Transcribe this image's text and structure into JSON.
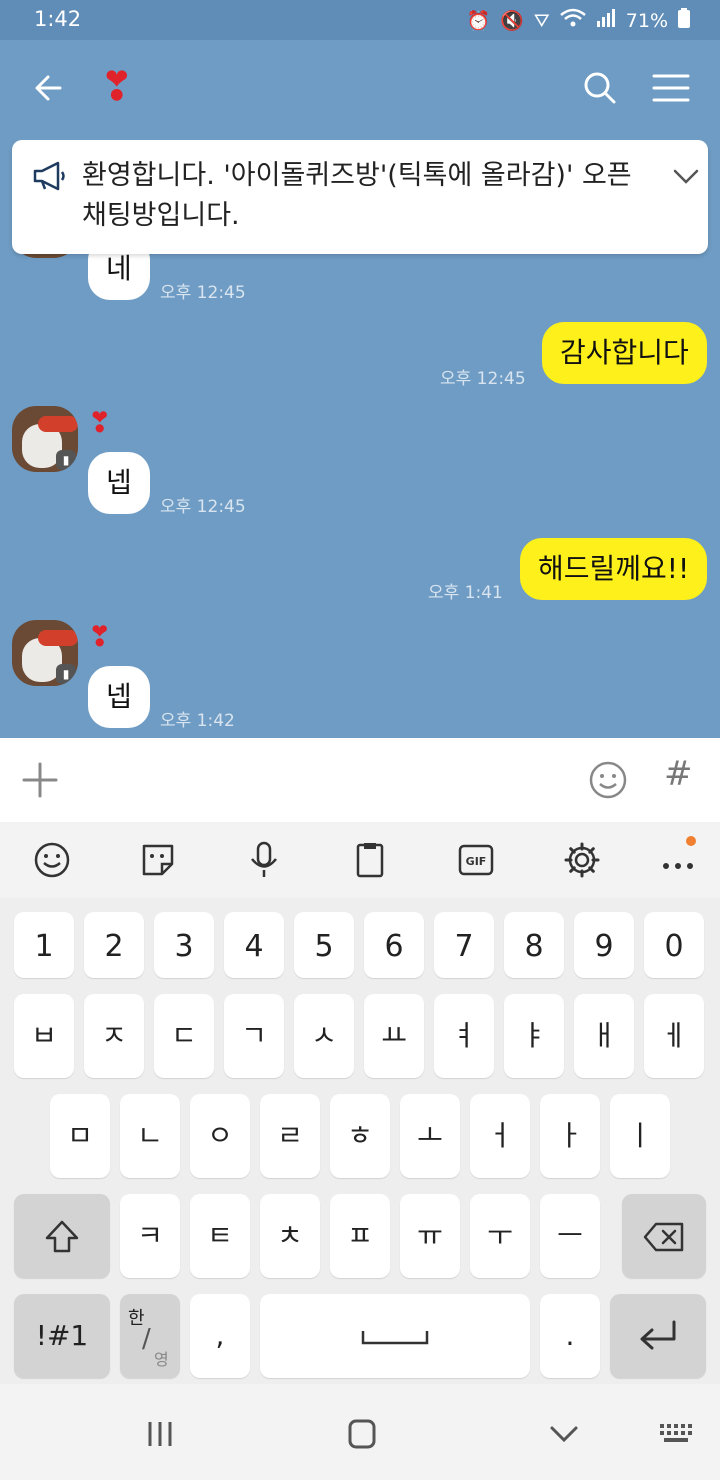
{
  "status": {
    "time": "1:42",
    "battery": "71%"
  },
  "header": {
    "title": "❣",
    "back_icon": "arrow-left-icon",
    "search_icon": "search-icon",
    "menu_icon": "menu-icon"
  },
  "notice": {
    "text": "환영합니다. '아이돌퀴즈방'(틱톡에 올라감)' 오픈채팅방입니다."
  },
  "messages": [
    {
      "side": "in",
      "text": "네",
      "time": "오후 12:45"
    },
    {
      "side": "out",
      "text": "감사합니다",
      "time": "오후 12:45"
    },
    {
      "side": "in",
      "sender": "❣",
      "text": "넵",
      "time": "오후 12:45"
    },
    {
      "side": "out",
      "text": "해드릴께요!!",
      "time": "오후 1:41"
    },
    {
      "side": "in",
      "sender": "❣",
      "text": "넵",
      "time": "오후 1:42"
    }
  ],
  "input": {
    "hash_label": "#"
  },
  "keyboard": {
    "row_numbers": [
      "1",
      "2",
      "3",
      "4",
      "5",
      "6",
      "7",
      "8",
      "9",
      "0"
    ],
    "row1": [
      "ㅂ",
      "ㅈ",
      "ㄷ",
      "ㄱ",
      "ㅅ",
      "ㅛ",
      "ㅕ",
      "ㅑ",
      "ㅐ",
      "ㅔ"
    ],
    "row2": [
      "ㅁ",
      "ㄴ",
      "ㅇ",
      "ㄹ",
      "ㅎ",
      "ㅗ",
      "ㅓ",
      "ㅏ",
      "ㅣ"
    ],
    "row3": [
      "ㅋ",
      "ㅌ",
      "ㅊ",
      "ㅍ",
      "ㅠ",
      "ㅜ",
      "ㅡ"
    ],
    "symbols_label": "!#1",
    "lang_top": "한",
    "lang_bottom": "영",
    "comma": ",",
    "period": "."
  }
}
